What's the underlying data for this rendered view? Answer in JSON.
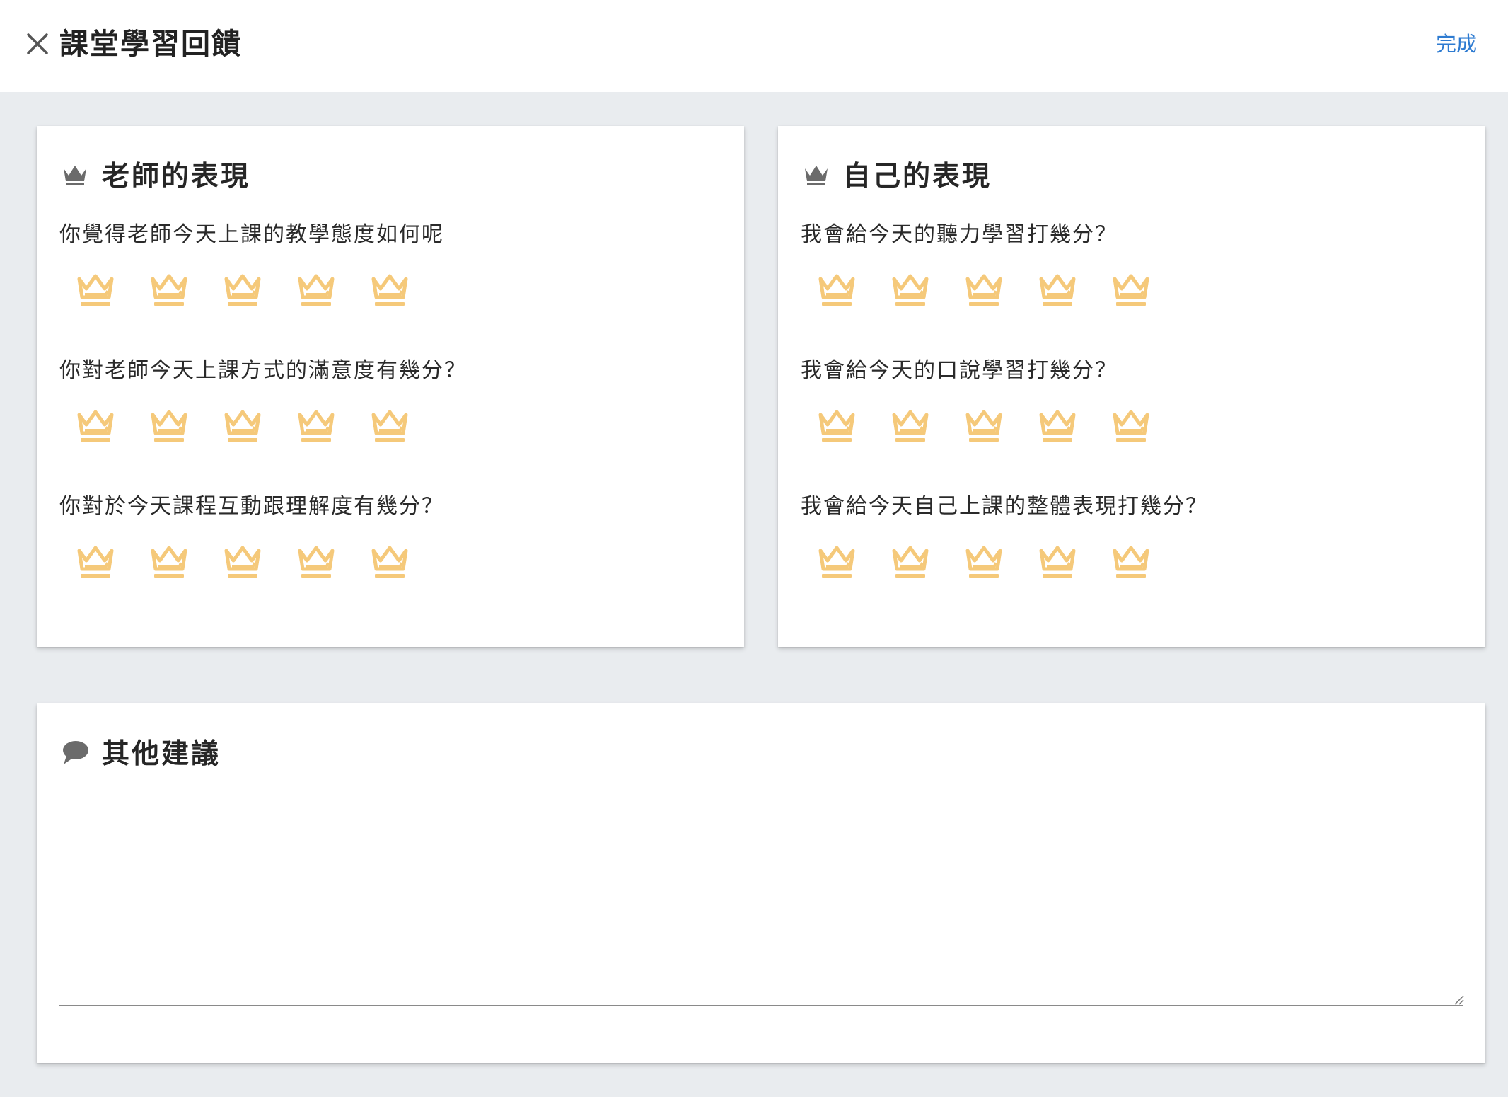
{
  "header": {
    "close_icon": "close-icon",
    "title": "課堂學習回饋",
    "done_label": "完成"
  },
  "colors": {
    "accent": "#2e7bd1",
    "star": "#f5c97a",
    "header_icon": "#6b6b6b",
    "background": "#e9ecef"
  },
  "teacher_section": {
    "icon": "crown-icon",
    "title": "老師的表現",
    "questions": [
      {
        "label": "你覺得老師今天上課的教學態度如何呢",
        "rating": 0,
        "max": 5
      },
      {
        "label": "你對老師今天上課方式的滿意度有幾分？",
        "rating": 0,
        "max": 5
      },
      {
        "label": "你對於今天課程互動跟理解度有幾分？",
        "rating": 0,
        "max": 5
      }
    ]
  },
  "self_section": {
    "icon": "crown-icon",
    "title": "自己的表現",
    "questions": [
      {
        "label": "我會給今天的聽力學習打幾分？",
        "rating": 0,
        "max": 5
      },
      {
        "label": "我會給今天的口說學習打幾分？",
        "rating": 0,
        "max": 5
      },
      {
        "label": "我會給今天自己上課的整體表現打幾分？",
        "rating": 0,
        "max": 5
      }
    ]
  },
  "suggestion_section": {
    "icon": "chat-bubble-icon",
    "title": "其他建議",
    "value": "",
    "placeholder": ""
  }
}
